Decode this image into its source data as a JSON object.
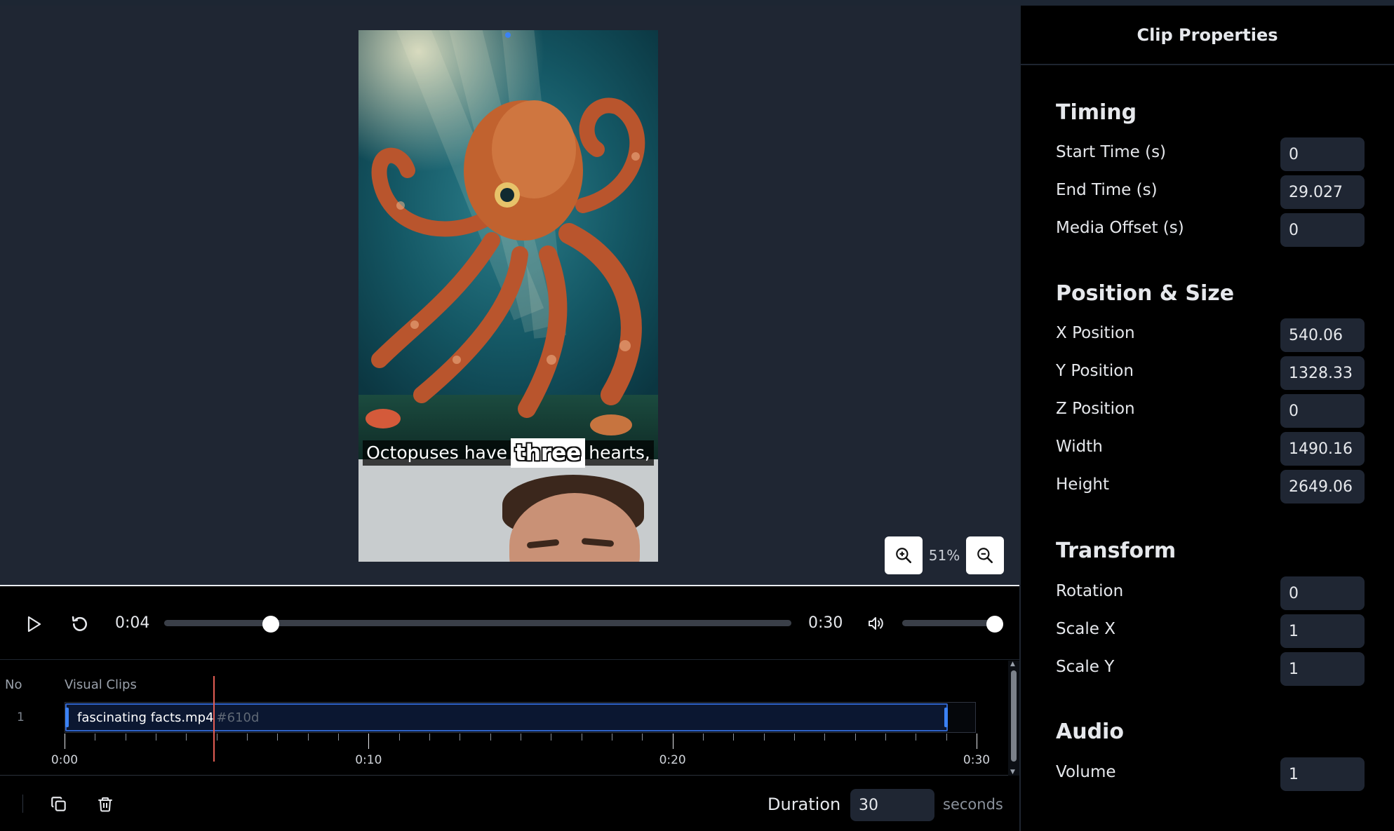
{
  "preview": {
    "caption_before": "Octopuses have",
    "caption_highlight": "three",
    "caption_after": "hearts,",
    "zoom_level": "51%"
  },
  "playback": {
    "current_time": "0:04",
    "total_time": "0:30",
    "progress_fraction": 0.17,
    "volume_fraction": 1.0
  },
  "timeline": {
    "col_no": "No",
    "col_visual": "Visual Clips",
    "rows": [
      {
        "no": "1",
        "clip_name": "fascinating facts.mp4",
        "clip_id": "#610d",
        "start_s": 0,
        "end_s": 29.027
      }
    ],
    "playhead_s": 4.9,
    "ruler_max_s": 30,
    "ruler_labels": [
      {
        "label": "0:00",
        "s": 0
      },
      {
        "label": "0:10",
        "s": 10
      },
      {
        "label": "0:20",
        "s": 20
      },
      {
        "label": "0:30",
        "s": 30
      }
    ]
  },
  "footer": {
    "duration_label": "Duration",
    "duration_value": "30",
    "duration_unit": "seconds"
  },
  "panel": {
    "title": "Clip Properties",
    "sections": {
      "timing": {
        "title": "Timing",
        "start_label": "Start Time (s)",
        "start_value": "0",
        "end_label": "End Time (s)",
        "end_value": "29.027",
        "offset_label": "Media Offset (s)",
        "offset_value": "0"
      },
      "position": {
        "title": "Position & Size",
        "x_label": "X Position",
        "x_value": "540.06",
        "y_label": "Y Position",
        "y_value": "1328.33",
        "z_label": "Z Position",
        "z_value": "0",
        "width_label": "Width",
        "width_value": "1490.16",
        "height_label": "Height",
        "height_value": "2649.06"
      },
      "transform": {
        "title": "Transform",
        "rotation_label": "Rotation",
        "rotation_value": "0",
        "scalex_label": "Scale X",
        "scalex_value": "1",
        "scaley_label": "Scale Y",
        "scaley_value": "1"
      },
      "audio": {
        "title": "Audio",
        "volume_label": "Volume",
        "volume_value": "1"
      }
    }
  },
  "colors": {
    "accent_blue": "#3b82f6",
    "playhead_red": "#e35d54",
    "panel_input_bg": "#1f2633"
  },
  "icons": [
    "play-icon",
    "restart-icon",
    "volume-icon",
    "zoom-in-icon",
    "zoom-out-icon",
    "duplicate-icon",
    "trash-icon"
  ]
}
